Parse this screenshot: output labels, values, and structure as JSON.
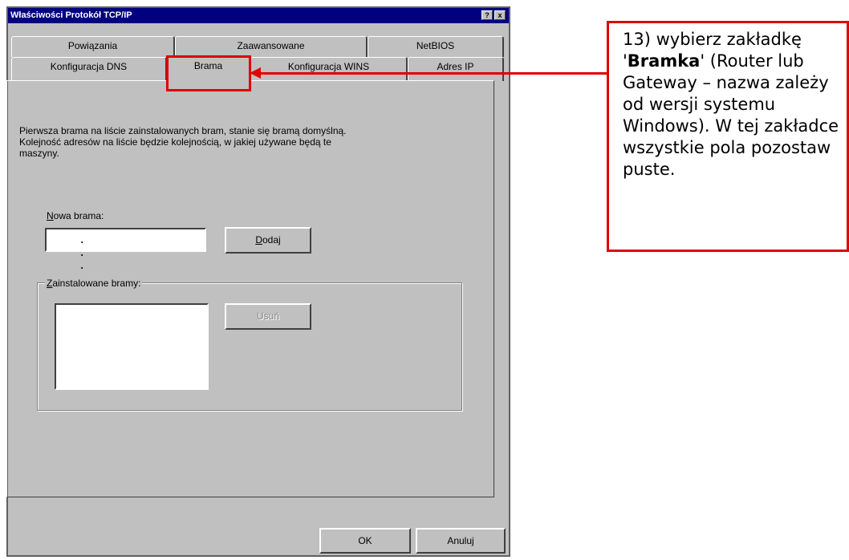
{
  "window": {
    "title": "Właściwości Protokół TCP/IP",
    "help_btn": "?",
    "close_btn": "x"
  },
  "tabs_row1": [
    "Powiązania",
    "Zaawansowane",
    "NetBIOS"
  ],
  "tabs_row2": [
    "Konfiguracja DNS",
    "Brama",
    "Konfiguracja WINS",
    "Adres IP"
  ],
  "selected_tab": "Brama",
  "description": "Pierwsza brama na liście zainstalowanych bram, stanie się bramą domyślną. Kolejność adresów na liście będzie kolejnością, w jakiej używane będą te maszyny.",
  "new_gateway": {
    "label_hotkey": "N",
    "label_rest": "owa brama:",
    "ip_value": ". . ."
  },
  "add_button": {
    "hotkey": "D",
    "rest": "odaj"
  },
  "installed": {
    "label_hotkey": "Z",
    "label_rest": "ainstalowane bramy:"
  },
  "remove_button": "Usuń",
  "footer": {
    "ok": "OK",
    "cancel": "Anuluj"
  },
  "annotation": {
    "line1": "13) wybierz zakładkę",
    "quote_open": "'",
    "bold": "Bramka",
    "quote_close": "'",
    "line2_rest": " (Router lub Gateway – nazwa zależy od wersji systemu Windows). W tej zakładce wszystkie pola pozostaw puste.",
    "accent_color": "#e00000"
  }
}
